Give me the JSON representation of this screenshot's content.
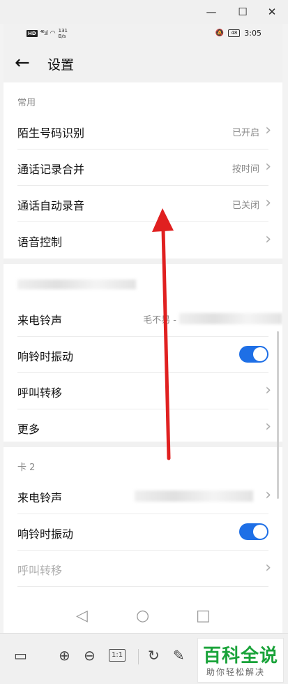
{
  "window": {
    "minimize": "—",
    "maximize": "☐",
    "close": "✕"
  },
  "statusbar": {
    "hd": "HD",
    "signal": "⁴⁶.ıl",
    "wifi": "◠",
    "speed_value": "131",
    "speed_unit": "B/s",
    "battery": "48",
    "time": "3:05"
  },
  "appbar": {
    "back_icon": "←",
    "title": "设置"
  },
  "section_common": {
    "header": "常用",
    "rows": [
      {
        "label": "陌生号码识别",
        "value": "已开启"
      },
      {
        "label": "通话记录合并",
        "value": "按时间"
      },
      {
        "label": "通话自动录音",
        "value": "已关闭"
      },
      {
        "label": "语音控制",
        "value": ""
      }
    ]
  },
  "section_card1": {
    "ringtone_label": "来电铃声",
    "ringtone_value": "毛不易 -",
    "vibrate_label": "响铃时振动",
    "vibrate_on": true,
    "forward_label": "呼叫转移",
    "more_label": "更多"
  },
  "section_card2": {
    "header": "卡 2",
    "ringtone_label": "来电铃声",
    "vibrate_label": "响铃时振动",
    "vibrate_on": true,
    "forward_label": "呼叫转移"
  },
  "chevron": "›",
  "navbar": {
    "back": "◁",
    "home": "○",
    "recent": "□"
  },
  "viewer_toolbar": {
    "panel_icon": "▭",
    "zoom_in": "⊕",
    "zoom_out": "⊖",
    "actual_size": "1:1",
    "rotate": "↻",
    "edit": "✎"
  },
  "watermark": {
    "main": "百科全说",
    "sub": "助你轻松解决"
  },
  "colors": {
    "accent": "#1e6fe6",
    "arrow": "#e02020",
    "watermark": "#1aa33a"
  }
}
